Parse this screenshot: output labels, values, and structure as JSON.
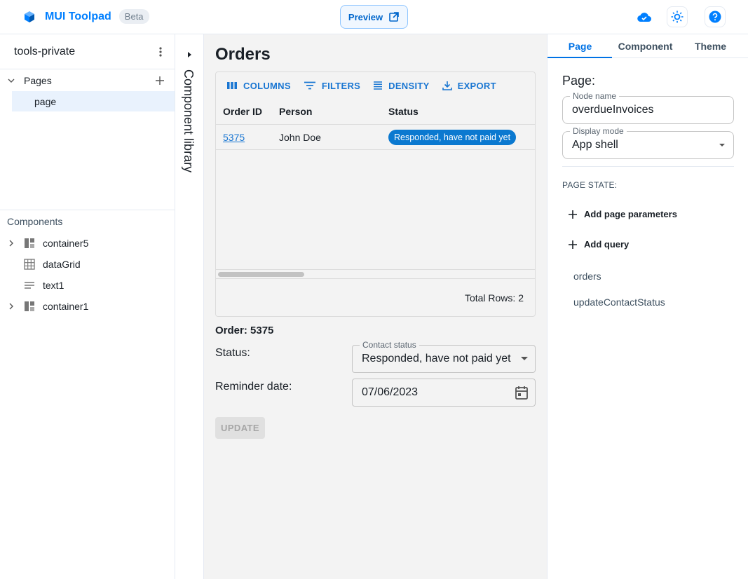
{
  "header": {
    "app_name": "MUI Toolpad",
    "badge": "Beta",
    "preview_label": "Preview",
    "icons": [
      "cloud-done-icon",
      "light-mode-icon",
      "help-icon"
    ]
  },
  "left_panel": {
    "project_name": "tools-private",
    "pages_label": "Pages",
    "pages": [
      "page"
    ],
    "components_label": "Components",
    "components": [
      {
        "name": "container5",
        "icon": "container-icon",
        "expandable": true
      },
      {
        "name": "dataGrid",
        "icon": "grid-icon",
        "expandable": false
      },
      {
        "name": "text1",
        "icon": "text-icon",
        "expandable": false
      },
      {
        "name": "container1",
        "icon": "container-icon",
        "expandable": true
      }
    ]
  },
  "rail": {
    "label": "Component library"
  },
  "canvas": {
    "title": "Orders",
    "grid": {
      "toolbar": [
        "COLUMNS",
        "FILTERS",
        "DENSITY",
        "EXPORT"
      ],
      "columns": [
        "Order ID",
        "Person",
        "Status"
      ],
      "rows": [
        {
          "id": "5375",
          "person": "John Doe",
          "status": "Responded, have not paid yet"
        }
      ],
      "footer": "Total Rows: 2"
    },
    "order_title": "Order: 5375",
    "status_label": "Status:",
    "contact_status_legend": "Contact status",
    "contact_status_value": "Responded, have not paid yet",
    "reminder_label": "Reminder date:",
    "reminder_value": "07/06/2023",
    "update_label": "UPDATE"
  },
  "right_panel": {
    "tabs": [
      "Page",
      "Component",
      "Theme"
    ],
    "active_tab": "Page",
    "heading": "Page:",
    "node_name_legend": "Node name",
    "node_name_value": "overdueInvoices",
    "display_mode_legend": "Display mode",
    "display_mode_value": "App shell",
    "state_title": "PAGE STATE:",
    "add_params_label": "Add page parameters",
    "add_query_label": "Add query",
    "queries": [
      "orders",
      "updateContactStatus"
    ]
  },
  "colors": {
    "brand": "#007fff",
    "accent": "#1976d2",
    "chip": "#0b79d0",
    "selected_bg": "#e9f2fd",
    "canvas_bg": "#f3f3f3"
  }
}
